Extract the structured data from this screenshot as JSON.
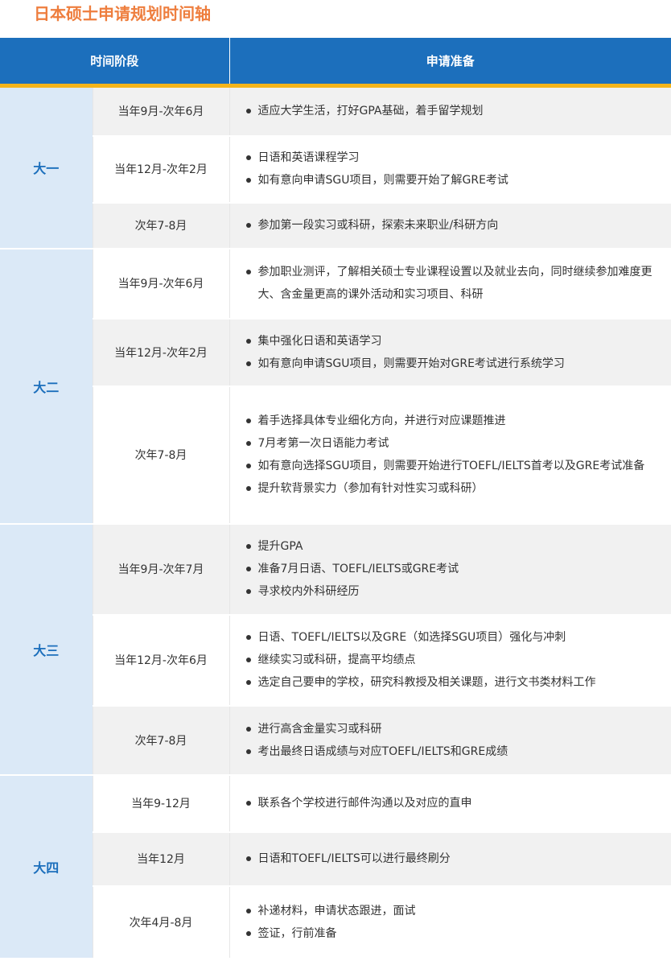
{
  "title": "日本硕士申请规划时间轴",
  "header": {
    "period": "时间阶段",
    "prep": "申请准备"
  },
  "years": [
    {
      "name": "大一",
      "rows": [
        {
          "period": "当年9月-次年6月",
          "items": [
            "适应大学生活，打好GPA基础，着手留学规划"
          ]
        },
        {
          "period": "当年12月-次年2月",
          "items": [
            "日语和英语课程学习",
            "如有意向申请SGU项目，则需要开始了解GRE考试"
          ]
        },
        {
          "period": "次年7-8月",
          "items": [
            "参加第一段实习或科研，探索未来职业/科研方向"
          ]
        }
      ]
    },
    {
      "name": "大二",
      "rows": [
        {
          "period": "当年9月-次年6月",
          "items": [
            "参加职业测评，了解相关硕士专业课程设置以及就业去向，同时继续参加难度更大、含金量更高的课外活动和实习项目、科研"
          ]
        },
        {
          "period": "当年12月-次年2月",
          "items": [
            "集中强化日语和英语学习",
            "如有意向申请SGU项目，则需要开始对GRE考试进行系统学习"
          ]
        },
        {
          "period": "次年7-8月",
          "items": [
            "着手选择具体专业细化方向，并进行对应课题推进",
            "7月考第一次日语能力考试",
            "如有意向选择SGU项目，则需要开始进行TOEFL/IELTS首考以及GRE考试准备",
            "提升软背景实力（参加有针对性实习或科研）"
          ]
        }
      ]
    },
    {
      "name": "大三",
      "rows": [
        {
          "period": "当年9月-次年7月",
          "items": [
            "提升GPA",
            "准备7月日语、TOEFL/IELTS或GRE考试",
            "寻求校内外科研经历"
          ]
        },
        {
          "period": "当年12月-次年6月",
          "items": [
            "日语、TOEFL/IELTS以及GRE（如选择SGU项目）强化与冲刺",
            "继续实习或科研，提高平均绩点",
            "选定自己要申的学校，研究科教授及相关课题，进行文书类材料工作"
          ]
        },
        {
          "period": "次年7-8月",
          "items": [
            "进行高含金量实习或科研",
            "考出最终日语成绩与对应TOEFL/IELTS和GRE成绩"
          ]
        }
      ]
    },
    {
      "name": "大四",
      "rows": [
        {
          "period": "当年9-12月",
          "items": [
            "联系各个学校进行邮件沟通以及对应的直申"
          ]
        },
        {
          "period": "当年12月",
          "items": [
            "日语和TOEFL/IELTS可以进行最终刷分"
          ]
        },
        {
          "period": "次年4月-8月",
          "items": [
            "补递材料，申请状态跟进，面试",
            "签证，行前准备"
          ]
        }
      ]
    }
  ]
}
